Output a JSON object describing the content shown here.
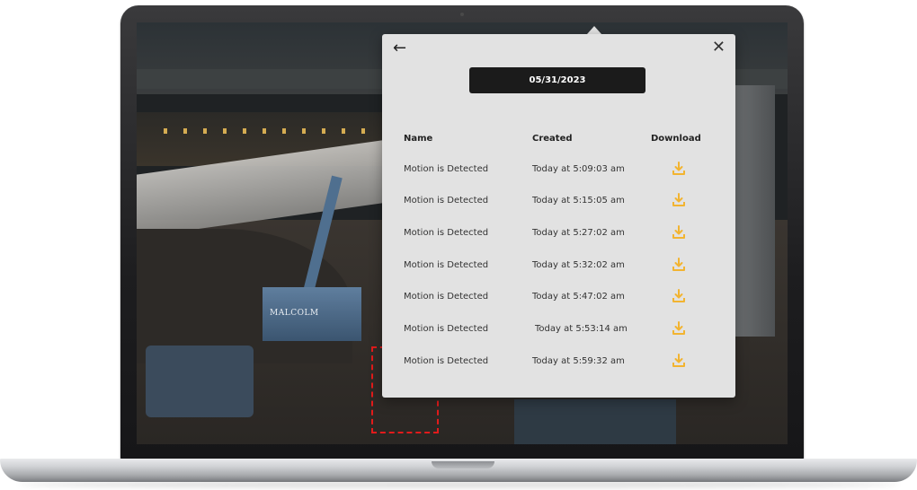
{
  "screen": {
    "equipment_label": "MALCOLM"
  },
  "popup": {
    "back_icon": "arrow-left-icon",
    "close_icon": "close-icon",
    "date": "05/31/2023",
    "columns": [
      "Name",
      "Created",
      "Download"
    ],
    "rows": [
      {
        "name": "Motion is Detected",
        "created": "Today at 5:09:03 am"
      },
      {
        "name": "Motion is Detected",
        "created": "Today at 5:15:05 am"
      },
      {
        "name": "Motion is Detected",
        "created": "Today at 5:27:02 am"
      },
      {
        "name": "Motion is Detected",
        "created": "Today at 5:32:02 am"
      },
      {
        "name": "Motion is Detected",
        "created": "Today at 5:47:02 am"
      },
      {
        "name": "Motion is Detected",
        "created": "Today at 5:53:14 am"
      },
      {
        "name": "Motion is Detected",
        "created": "Today at 5:59:32 am"
      }
    ],
    "download_icon": "download-icon"
  },
  "colors": {
    "accent": "#f2b431",
    "date_bg": "#1b1b1b",
    "popup_bg": "#e2e2e2",
    "motion_box": "#e21b1b"
  }
}
